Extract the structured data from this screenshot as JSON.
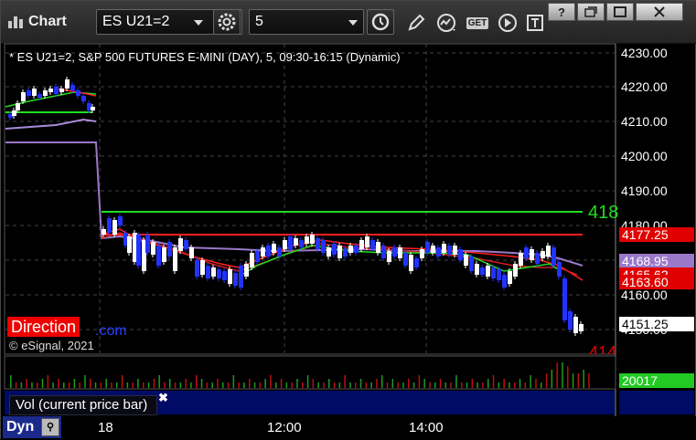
{
  "toolbar": {
    "title": "Chart",
    "symbol": "ES U21=2",
    "interval": "5",
    "get_label": "GET",
    "help": "?"
  },
  "chart": {
    "info": "* ES U21=2, S&P 500 FUTURES E-MINI (DAY), 5, 09:30-16:15 (Dynamic)",
    "direction_label": "Direction",
    "partial_text": ".com",
    "copyright": "© eSignal, 2021",
    "green_line_label": "418",
    "cut_label": "414",
    "y_ticks": [
      "4230.00",
      "4220.00",
      "4210.00",
      "4200.00",
      "4190.00",
      "4180.00",
      "4170.00",
      "4160.00",
      "4150.00"
    ],
    "price_tags": [
      {
        "text": "4177.25",
        "bg": "#e10000",
        "fg": "#fff"
      },
      {
        "text": "4168.95",
        "bg": "#9a79c9",
        "fg": "#fff"
      },
      {
        "text": "4165.62",
        "bg": "#e10000",
        "fg": "#fff"
      },
      {
        "text": "4163.60",
        "bg": "#e10000",
        "fg": "#fff"
      },
      {
        "text": "4151.25",
        "bg": "#ffffff",
        "fg": "#000"
      }
    ],
    "vol_tag": "20017",
    "vol_label": "Vol (current price bar)",
    "time_labels": [
      "18",
      "12:00",
      "14:00"
    ],
    "dyn_label": "Dyn",
    "colors": {
      "up": "#ffffff",
      "down": "#2233ff",
      "red_line": "#ff2020",
      "green_line": "#22dd22",
      "purple": "#a98bd8"
    }
  }
}
